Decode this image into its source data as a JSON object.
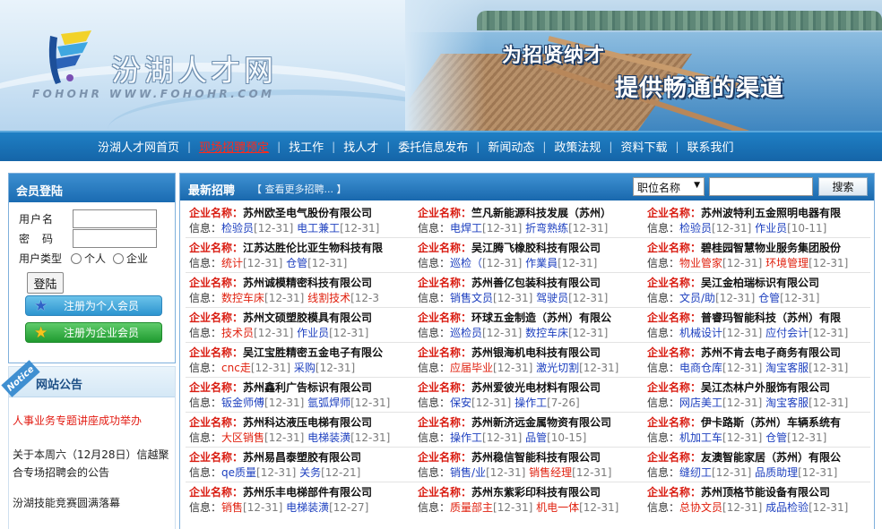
{
  "header": {
    "site_title": "汾湖人才网",
    "site_subtitle": "FOHOHR  WWW.FOHOHR.COM",
    "slogan_1": "为招贤纳才",
    "slogan_2": "提供畅通的渠道"
  },
  "nav": {
    "items": [
      {
        "label": "汾湖人才网首页"
      },
      {
        "label": "现场招聘预定",
        "hot": true
      },
      {
        "label": "找工作"
      },
      {
        "label": "找人才"
      },
      {
        "label": "委托信息发布"
      },
      {
        "label": "新闻动态"
      },
      {
        "label": "政策法规"
      },
      {
        "label": "资料下载"
      },
      {
        "label": "联系我们"
      }
    ],
    "separator": "|"
  },
  "login": {
    "title": "会员登陆",
    "username_label": "用户名",
    "password_label": "密　码",
    "usertype_label": "用户类型",
    "type_options": [
      "个人",
      "企业"
    ],
    "login_button": "登陆",
    "register_person": "注册为个人会员",
    "register_company": "注册为企业会员"
  },
  "notice": {
    "ribbon": "Notice",
    "title": "网站公告",
    "items": [
      {
        "text": "人事业务专题讲座成功举办",
        "red": true
      },
      {
        "text": "关于本周六（12月28日）信越聚合专场招聘会的公告"
      },
      {
        "text": "汾湖技能竞赛圆满落幕"
      }
    ]
  },
  "jobs": {
    "title": "最新招聘",
    "more": "【 查看更多招聘... 】",
    "search_select": "职位名称",
    "search_placeholder": "",
    "search_button": "搜索",
    "company_tag": "企业名称：",
    "info_tag": "信息：",
    "columns": [
      [
        {
          "company": "苏州欧圣电气股份有限公司",
          "positions": [
            {
              "name": "检验员",
              "date": "[12-31]"
            },
            {
              "name": "电工兼工",
              "date": "[12-31]"
            }
          ]
        },
        {
          "company": "江苏达胜伦比亚生物科技有限",
          "positions": [
            {
              "name": "统计",
              "date": "[12-31]",
              "red": true
            },
            {
              "name": "仓管",
              "date": "[12-31]"
            }
          ]
        },
        {
          "company": "苏州诚模精密科技有限公司",
          "positions": [
            {
              "name": "数控车床",
              "date": "[12-31]",
              "red": true
            },
            {
              "name": "线割技术",
              "date": "[12-3",
              "red": true
            }
          ]
        },
        {
          "company": "苏州文硕塑胶模具有限公司",
          "positions": [
            {
              "name": "技术员",
              "date": "[12-31]",
              "red": true
            },
            {
              "name": "作业员",
              "date": "[12-31]"
            }
          ]
        },
        {
          "company": "吴江宝胜精密五金电子有限公",
          "positions": [
            {
              "name": "cnc走",
              "date": "[12-31]",
              "red": true
            },
            {
              "name": "采购",
              "date": "[12-31]"
            }
          ]
        },
        {
          "company": "苏州鑫利广告标识有限公司",
          "positions": [
            {
              "name": "钣金师傅",
              "date": "[12-31]"
            },
            {
              "name": "氩弧焊师",
              "date": "[12-31]"
            }
          ]
        },
        {
          "company": "苏州科达液压电梯有限公司",
          "positions": [
            {
              "name": "大区销售",
              "date": "[12-31]",
              "red": true
            },
            {
              "name": "电梯装潢",
              "date": "[12-31]"
            }
          ]
        },
        {
          "company": "苏州易昌泰塑胶有限公司",
          "positions": [
            {
              "name": "qe质量",
              "date": "[12-31]"
            },
            {
              "name": "关务",
              "date": "[12-21]"
            }
          ]
        },
        {
          "company": "苏州乐丰电梯部件有限公司",
          "positions": [
            {
              "name": "销售",
              "date": "[12-31]",
              "red": true
            },
            {
              "name": "电梯装潢",
              "date": "[12-27]"
            }
          ]
        }
      ],
      [
        {
          "company": "竺凡新能源科技发展（苏州）",
          "positions": [
            {
              "name": "电焊工",
              "date": "[12-31]"
            },
            {
              "name": "折弯熟练",
              "date": "[12-31]"
            }
          ]
        },
        {
          "company": "吴江腾飞橡胶科技有限公司",
          "positions": [
            {
              "name": "巡检（",
              "date": "[12-31]"
            },
            {
              "name": "作業員",
              "date": "[12-31]"
            }
          ]
        },
        {
          "company": "苏州善亿包装科技有限公司",
          "positions": [
            {
              "name": "销售文员",
              "date": "[12-31]"
            },
            {
              "name": "驾驶员",
              "date": "[12-31]"
            }
          ]
        },
        {
          "company": "环球五金制造（苏州）有限公",
          "positions": [
            {
              "name": "巡检员",
              "date": "[12-31]"
            },
            {
              "name": "数控车床",
              "date": "[12-31]"
            }
          ]
        },
        {
          "company": "苏州银海机电科技有限公司",
          "positions": [
            {
              "name": "应届毕业",
              "date": "[12-31]",
              "red": true
            },
            {
              "name": "激光切割",
              "date": "[12-31]"
            }
          ]
        },
        {
          "company": "苏州爱彼光电材料有限公司",
          "positions": [
            {
              "name": "保安",
              "date": "[12-31]"
            },
            {
              "name": "操作工",
              "date": "[7-26]"
            }
          ]
        },
        {
          "company": "苏州新济远金属物资有限公司",
          "positions": [
            {
              "name": "操作工",
              "date": "[12-31]"
            },
            {
              "name": "品管",
              "date": "[10-15]"
            }
          ]
        },
        {
          "company": "苏州稳信智能科技有限公司",
          "positions": [
            {
              "name": "销售/业",
              "date": "[12-31]"
            },
            {
              "name": "销售经理",
              "date": "[12-31]",
              "red": true
            }
          ]
        },
        {
          "company": "苏州东紫彩印科技有限公司",
          "positions": [
            {
              "name": "质量部主",
              "date": "[12-31]",
              "red": true
            },
            {
              "name": "机电一体",
              "date": "[12-31]",
              "red": true
            }
          ]
        }
      ],
      [
        {
          "company": "苏州波特利五金照明电器有限",
          "positions": [
            {
              "name": "检验员",
              "date": "[12-31]"
            },
            {
              "name": "作业员",
              "date": "[10-11]"
            }
          ]
        },
        {
          "company": "碧桂园智慧物业服务集团股份",
          "positions": [
            {
              "name": "物业管家",
              "date": "[12-31]",
              "red": true
            },
            {
              "name": "环境管理",
              "date": "[12-31]",
              "red": true
            }
          ]
        },
        {
          "company": "吴江金柏瑞标识有限公司",
          "positions": [
            {
              "name": "文员/助",
              "date": "[12-31]"
            },
            {
              "name": "仓管",
              "date": "[12-31]"
            }
          ]
        },
        {
          "company": "普睿玛智能科技（苏州）有限",
          "positions": [
            {
              "name": "机械设计",
              "date": "[12-31]"
            },
            {
              "name": "应付会计",
              "date": "[12-31]"
            }
          ]
        },
        {
          "company": "苏州不肯去电子商务有限公司",
          "positions": [
            {
              "name": "电商仓库",
              "date": "[12-31]"
            },
            {
              "name": "淘宝客服",
              "date": "[12-31]"
            }
          ]
        },
        {
          "company": "吴江杰林户外服饰有限公司",
          "positions": [
            {
              "name": "网店美工",
              "date": "[12-31]"
            },
            {
              "name": "淘宝客服",
              "date": "[12-31]"
            }
          ]
        },
        {
          "company": "伊卡路斯（苏州）车辆系统有",
          "positions": [
            {
              "name": "机加工车",
              "date": "[12-31]"
            },
            {
              "name": "仓管",
              "date": "[12-31]"
            }
          ]
        },
        {
          "company": "友澳智能家居（苏州）有限公",
          "positions": [
            {
              "name": "缝纫工",
              "date": "[12-31]"
            },
            {
              "name": "品质助理",
              "date": "[12-31]"
            }
          ]
        },
        {
          "company": "苏州顶格节能设备有限公司",
          "positions": [
            {
              "name": "总协文员",
              "date": "[12-31]",
              "red": true
            },
            {
              "name": "成品检验",
              "date": "[12-31]"
            }
          ]
        }
      ]
    ]
  }
}
